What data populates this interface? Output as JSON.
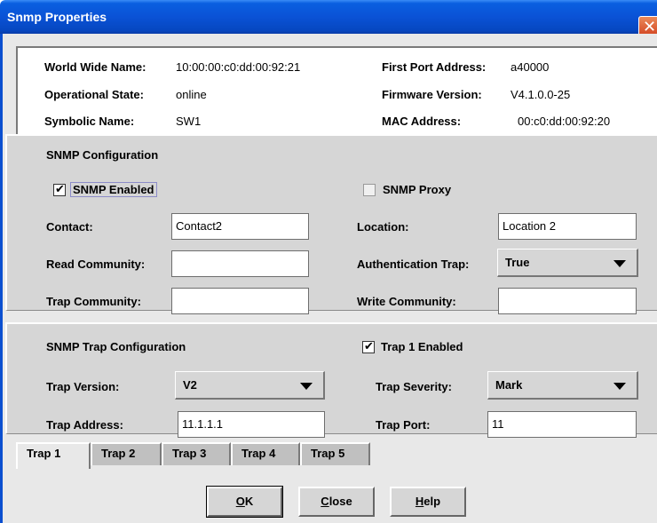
{
  "window": {
    "title": "Snmp Properties",
    "close_glyph": "✕"
  },
  "info": {
    "wwn_label": "World Wide Name:",
    "wwn_value": "10:00:00:c0:dd:00:92:21",
    "state_label": "Operational State:",
    "state_value": "online",
    "symbolic_label": "Symbolic Name:",
    "symbolic_value": "SW1",
    "port_label": "First Port Address:",
    "port_value": "a40000",
    "firmware_label": "Firmware Version:",
    "firmware_value": "V4.1.0.0-25",
    "mac_label": "MAC Address:",
    "mac_value": "00:c0:dd:00:92:20"
  },
  "snmp": {
    "section_title": "SNMP Configuration",
    "enabled_label": "SNMP Enabled",
    "enabled_checked": true,
    "proxy_label": "SNMP Proxy",
    "proxy_checked": false,
    "contact_label": "Contact:",
    "contact_value": "Contact2",
    "location_label": "Location:",
    "location_value": "Location 2",
    "read_label": "Read Community:",
    "read_value": "",
    "auth_label": "Authentication Trap:",
    "auth_value": "True",
    "trap_comm_label": "Trap Community:",
    "trap_comm_value": "",
    "write_label": "Write Community:",
    "write_value": ""
  },
  "trap": {
    "section_title": "SNMP Trap Configuration",
    "enabled_label": "Trap 1 Enabled",
    "enabled_checked": true,
    "version_label": "Trap Version:",
    "version_value": "V2",
    "severity_label": "Trap Severity:",
    "severity_value": "Mark",
    "address_label": "Trap Address:",
    "address_value": "11.1.1.1",
    "port_label": "Trap Port:",
    "port_value": "11"
  },
  "tabs": [
    "Trap 1",
    "Trap 2",
    "Trap 3",
    "Trap 4",
    "Trap 5"
  ],
  "active_tab": "Trap 1",
  "buttons": {
    "ok_key": "O",
    "ok_rest": "K",
    "close_key": "C",
    "close_rest": "lose",
    "help_key": "H",
    "help_rest": "elp"
  },
  "check_glyph": "✔"
}
